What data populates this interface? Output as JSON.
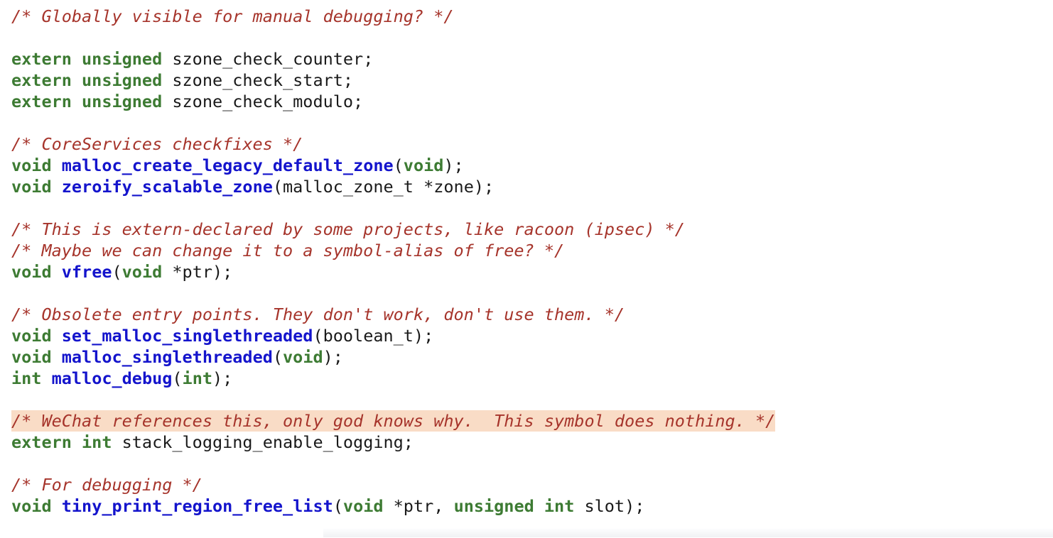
{
  "editor": {
    "background_color": "#ffffff",
    "font_size_px": 23.5,
    "line_height_px": 30,
    "colors": {
      "comment": "#a6342b",
      "keyword": "#3d7b33",
      "function": "#1414cc",
      "plain": "#1a1a1a",
      "highlight_background": "#f9dcc6",
      "scrollbar": "#f2f3f5"
    }
  },
  "code": {
    "lines": [
      {
        "id": "line-1",
        "highlighted": false,
        "tokens": [
          {
            "t": "comment",
            "v": "/* Globally visible for manual debugging? */"
          }
        ]
      },
      {
        "id": "line-2",
        "blank": true,
        "highlighted": false,
        "tokens": []
      },
      {
        "id": "line-3",
        "highlighted": false,
        "tokens": [
          {
            "t": "keyword",
            "v": "extern unsigned"
          },
          {
            "t": "plain",
            "v": " szone_check_counter;"
          }
        ]
      },
      {
        "id": "line-4",
        "highlighted": false,
        "tokens": [
          {
            "t": "keyword",
            "v": "extern unsigned"
          },
          {
            "t": "plain",
            "v": " szone_check_start;"
          }
        ]
      },
      {
        "id": "line-5",
        "highlighted": false,
        "tokens": [
          {
            "t": "keyword",
            "v": "extern unsigned"
          },
          {
            "t": "plain",
            "v": " szone_check_modulo;"
          }
        ]
      },
      {
        "id": "line-6",
        "blank": true,
        "highlighted": false,
        "tokens": []
      },
      {
        "id": "line-7",
        "highlighted": false,
        "tokens": [
          {
            "t": "comment",
            "v": "/* CoreServices checkfixes */"
          }
        ]
      },
      {
        "id": "line-8",
        "highlighted": false,
        "tokens": [
          {
            "t": "keyword",
            "v": "void"
          },
          {
            "t": "plain",
            "v": " "
          },
          {
            "t": "func",
            "v": "malloc_create_legacy_default_zone"
          },
          {
            "t": "plain",
            "v": "("
          },
          {
            "t": "keyword",
            "v": "void"
          },
          {
            "t": "plain",
            "v": ");"
          }
        ]
      },
      {
        "id": "line-9",
        "highlighted": false,
        "tokens": [
          {
            "t": "keyword",
            "v": "void"
          },
          {
            "t": "plain",
            "v": " "
          },
          {
            "t": "func",
            "v": "zeroify_scalable_zone"
          },
          {
            "t": "plain",
            "v": "(malloc_zone_t *zone);"
          }
        ]
      },
      {
        "id": "line-10",
        "blank": true,
        "highlighted": false,
        "tokens": []
      },
      {
        "id": "line-11",
        "highlighted": false,
        "tokens": [
          {
            "t": "comment",
            "v": "/* This is extern-declared by some projects, like racoon (ipsec) */"
          }
        ]
      },
      {
        "id": "line-12",
        "highlighted": false,
        "tokens": [
          {
            "t": "comment",
            "v": "/* Maybe we can change it to a symbol-alias of free? */"
          }
        ]
      },
      {
        "id": "line-13",
        "highlighted": false,
        "tokens": [
          {
            "t": "keyword",
            "v": "void"
          },
          {
            "t": "plain",
            "v": " "
          },
          {
            "t": "func",
            "v": "vfree"
          },
          {
            "t": "plain",
            "v": "("
          },
          {
            "t": "keyword",
            "v": "void"
          },
          {
            "t": "plain",
            "v": " *ptr);"
          }
        ]
      },
      {
        "id": "line-14",
        "blank": true,
        "highlighted": false,
        "tokens": []
      },
      {
        "id": "line-15",
        "highlighted": false,
        "tokens": [
          {
            "t": "comment",
            "v": "/* Obsolete entry points. They don't work, don't use them. */"
          }
        ]
      },
      {
        "id": "line-16",
        "highlighted": false,
        "tokens": [
          {
            "t": "keyword",
            "v": "void"
          },
          {
            "t": "plain",
            "v": " "
          },
          {
            "t": "func",
            "v": "set_malloc_singlethreaded"
          },
          {
            "t": "plain",
            "v": "(boolean_t);"
          }
        ]
      },
      {
        "id": "line-17",
        "highlighted": false,
        "tokens": [
          {
            "t": "keyword",
            "v": "void"
          },
          {
            "t": "plain",
            "v": " "
          },
          {
            "t": "func",
            "v": "malloc_singlethreaded"
          },
          {
            "t": "plain",
            "v": "("
          },
          {
            "t": "keyword",
            "v": "void"
          },
          {
            "t": "plain",
            "v": ");"
          }
        ]
      },
      {
        "id": "line-18",
        "highlighted": false,
        "tokens": [
          {
            "t": "keyword",
            "v": "int"
          },
          {
            "t": "plain",
            "v": " "
          },
          {
            "t": "func",
            "v": "malloc_debug"
          },
          {
            "t": "plain",
            "v": "("
          },
          {
            "t": "keyword",
            "v": "int"
          },
          {
            "t": "plain",
            "v": ");"
          }
        ]
      },
      {
        "id": "line-19",
        "blank": true,
        "highlighted": false,
        "tokens": []
      },
      {
        "id": "line-20",
        "highlighted": true,
        "tokens": [
          {
            "t": "comment",
            "v": "/* WeChat references this, only god knows why.  This symbol does nothing. */"
          }
        ]
      },
      {
        "id": "line-21",
        "highlighted": false,
        "tokens": [
          {
            "t": "keyword",
            "v": "extern int"
          },
          {
            "t": "plain",
            "v": " stack_logging_enable_logging;"
          }
        ]
      },
      {
        "id": "line-22",
        "blank": true,
        "highlighted": false,
        "tokens": []
      },
      {
        "id": "line-23",
        "highlighted": false,
        "tokens": [
          {
            "t": "comment",
            "v": "/* For debugging */"
          }
        ]
      },
      {
        "id": "line-24",
        "highlighted": false,
        "tokens": [
          {
            "t": "keyword",
            "v": "void"
          },
          {
            "t": "plain",
            "v": " "
          },
          {
            "t": "func",
            "v": "tiny_print_region_free_list"
          },
          {
            "t": "plain",
            "v": "("
          },
          {
            "t": "keyword",
            "v": "void"
          },
          {
            "t": "plain",
            "v": " *ptr, "
          },
          {
            "t": "keyword",
            "v": "unsigned int"
          },
          {
            "t": "plain",
            "v": " slot);"
          }
        ]
      }
    ]
  },
  "scrollbar": {
    "orientation": "horizontal",
    "visible": true
  }
}
